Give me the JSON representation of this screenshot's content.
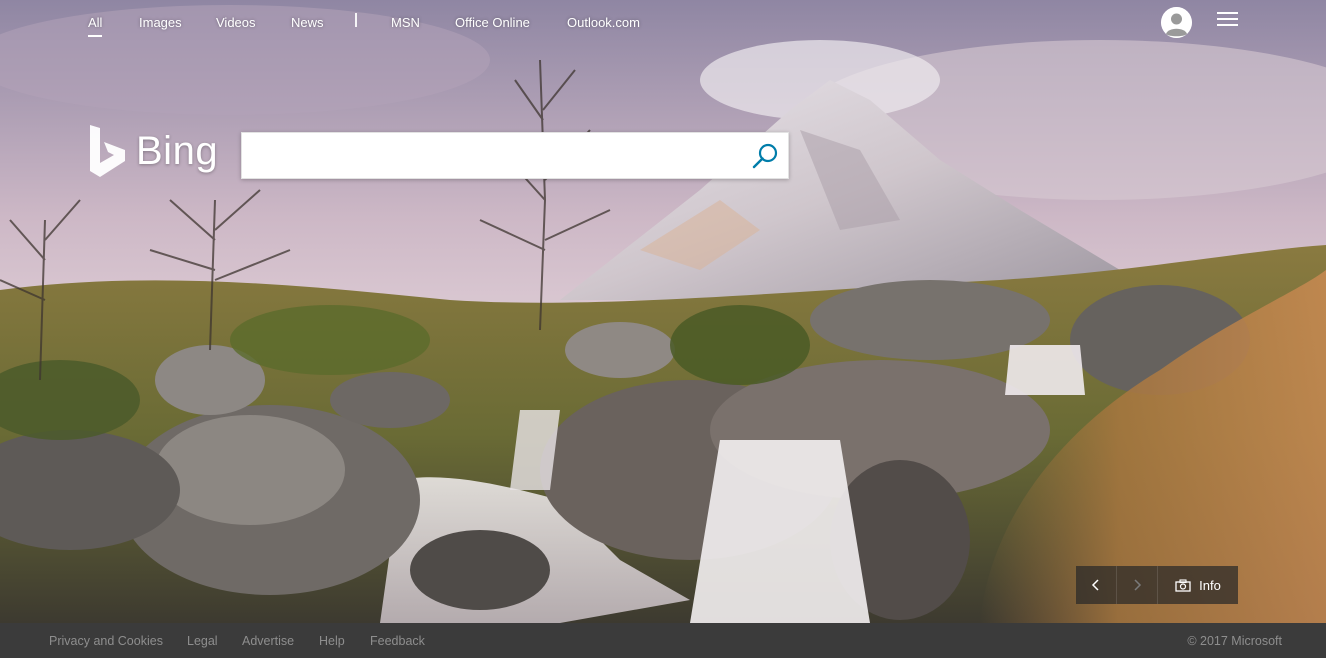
{
  "nav": {
    "items": [
      {
        "label": "All",
        "active": true
      },
      {
        "label": "Images"
      },
      {
        "label": "Videos"
      },
      {
        "label": "News"
      },
      {
        "label": "MSN"
      },
      {
        "label": "Office Online"
      },
      {
        "label": "Outlook.com"
      }
    ]
  },
  "header": {
    "avatar_icon": "user-avatar-icon",
    "menu_icon": "hamburger-menu-icon"
  },
  "logo": {
    "text": "Bing"
  },
  "search": {
    "value": "",
    "placeholder": "",
    "icon": "search-icon",
    "accent": "#007daa"
  },
  "image_controls": {
    "prev_icon": "chevron-left-icon",
    "next_icon": "chevron-right-icon",
    "camera_icon": "camera-icon",
    "info_label": "Info"
  },
  "footer": {
    "links": [
      "Privacy and Cookies",
      "Legal",
      "Advertise",
      "Help",
      "Feedback"
    ],
    "copyright": "© 2017 Microsoft"
  },
  "colors": {
    "footer_bg": "#3b3b3b",
    "footer_text": "#8e8e8e",
    "nav_text": "#ffffff"
  }
}
